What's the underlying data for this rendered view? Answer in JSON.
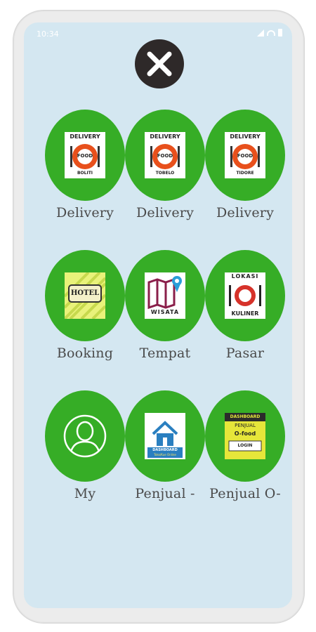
{
  "status_bar": {
    "time": "10:34"
  },
  "close_button": {
    "icon": "close-icon"
  },
  "colors": {
    "screen_bg": "#d4e7f1",
    "circle": "#36ad26",
    "close_bg": "#2e2929"
  },
  "tiles": [
    {
      "label": "Delivery",
      "icon": "delivery-food-logo",
      "logo": {
        "top": "DELIVERY",
        "mid": "FOOD",
        "bottom": "BOLITI"
      }
    },
    {
      "label": "Delivery",
      "icon": "delivery-food-logo",
      "logo": {
        "top": "DELIVERY",
        "mid": "FOOD",
        "bottom": "TOBELO"
      }
    },
    {
      "label": "Delivery",
      "icon": "delivery-food-logo",
      "logo": {
        "top": "DELIVERY",
        "mid": "FOOD",
        "bottom": "TIDORE"
      }
    },
    {
      "label": "Booking",
      "icon": "hotel-sign-icon",
      "logo": {
        "text": "HOTEL"
      }
    },
    {
      "label": "Tempat",
      "icon": "map-pin-icon",
      "logo": {
        "text": "WISATA"
      }
    },
    {
      "label": "Pasar",
      "icon": "plate-cutlery-icon",
      "logo": {
        "top": "LOKASI",
        "bottom": "KULINER"
      }
    },
    {
      "label": "My",
      "icon": "user-profile-icon"
    },
    {
      "label": "Penjual -",
      "icon": "house-icon",
      "logo": {
        "text": "DASHBOARD",
        "sub": "Toko/Kue Online"
      }
    },
    {
      "label": "Penjual O-",
      "icon": "dashboard-logo",
      "logo": {
        "top": "DASHBOARD",
        "mid": "PENJUAL",
        "accent": "O-food",
        "bottom": "LOGIN"
      }
    }
  ]
}
